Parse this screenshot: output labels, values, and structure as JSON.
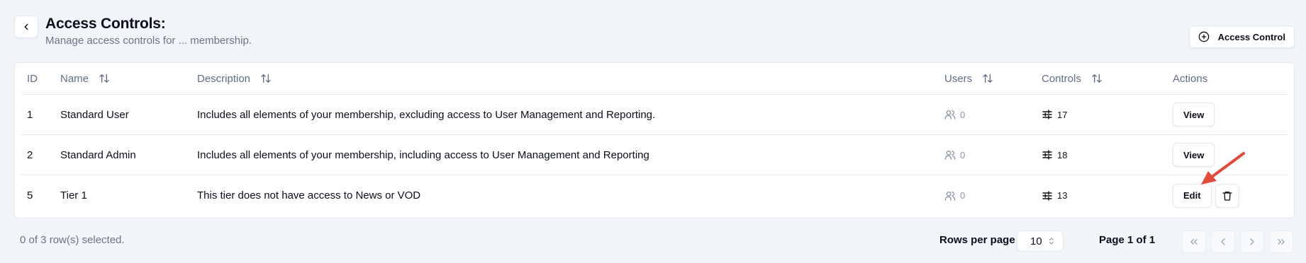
{
  "header": {
    "title": "Access Controls:",
    "subtitle": "Manage access controls for ... membership.",
    "add_button_label": "Access Control"
  },
  "table": {
    "columns": {
      "id": "ID",
      "name": "Name",
      "description": "Description",
      "users": "Users",
      "controls": "Controls",
      "actions": "Actions"
    },
    "rows": [
      {
        "id": "1",
        "name": "Standard User",
        "description": "Includes all elements of your membership, excluding access to User Management and Reporting.",
        "users": "0",
        "controls": "17",
        "action": "View"
      },
      {
        "id": "2",
        "name": "Standard Admin",
        "description": "Includes all elements of your membership, including access to User Management and Reporting",
        "users": "0",
        "controls": "18",
        "action": "View"
      },
      {
        "id": "5",
        "name": "Tier 1",
        "description": "This tier does not have access to News or VOD",
        "users": "0",
        "controls": "13",
        "action": "Edit"
      }
    ]
  },
  "footer": {
    "selection": "0 of 3 row(s) selected.",
    "rows_per_page_label": "Rows per page",
    "rows_per_page_value": "10",
    "page_info": "Page 1 of 1"
  },
  "colors": {
    "background": "#f1f4f9",
    "annotation_arrow": "#e04b3a"
  },
  "icons": [
    "chevron-left-icon",
    "plus-circle-icon",
    "sort-icon",
    "users-icon",
    "sliders-icon",
    "trash-icon",
    "chevrons-left-icon",
    "chevron-right-icon",
    "chevrons-right-icon"
  ]
}
